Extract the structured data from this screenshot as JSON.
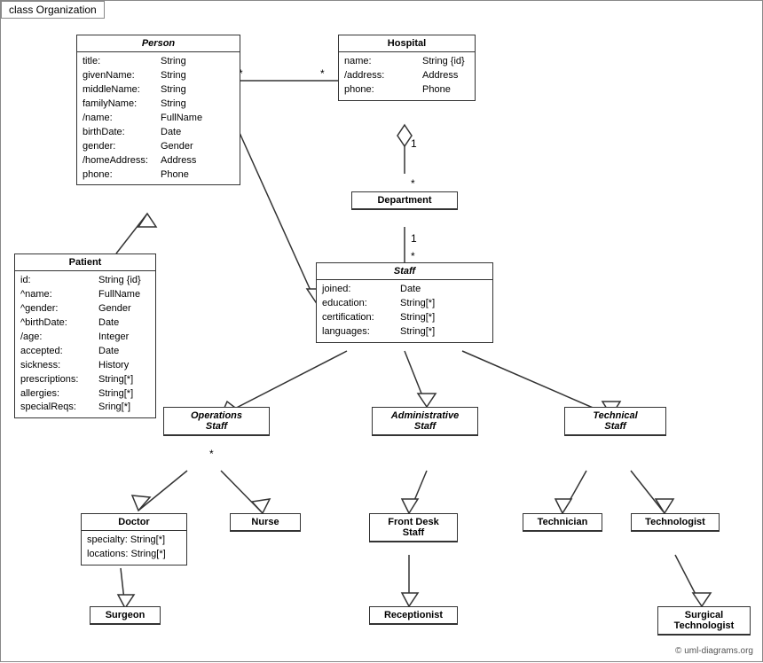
{
  "title": "class Organization",
  "classes": {
    "person": {
      "name": "Person",
      "italic": true,
      "attrs": [
        [
          "title:",
          "String"
        ],
        [
          "givenName:",
          "String"
        ],
        [
          "middleName:",
          "String"
        ],
        [
          "familyName:",
          "String"
        ],
        [
          "/name:",
          "FullName"
        ],
        [
          "birthDate:",
          "Date"
        ],
        [
          "gender:",
          "Gender"
        ],
        [
          "/homeAddress:",
          "Address"
        ],
        [
          "phone:",
          "Phone"
        ]
      ]
    },
    "hospital": {
      "name": "Hospital",
      "italic": false,
      "attrs": [
        [
          "name:",
          "String {id}"
        ],
        [
          "/address:",
          "Address"
        ],
        [
          "phone:",
          "Phone"
        ]
      ]
    },
    "department": {
      "name": "Department",
      "italic": false,
      "attrs": []
    },
    "staff": {
      "name": "Staff",
      "italic": true,
      "attrs": [
        [
          "joined:",
          "Date"
        ],
        [
          "education:",
          "String[*]"
        ],
        [
          "certification:",
          "String[*]"
        ],
        [
          "languages:",
          "String[*]"
        ]
      ]
    },
    "patient": {
      "name": "Patient",
      "italic": false,
      "attrs": [
        [
          "id:",
          "String {id}"
        ],
        [
          "^name:",
          "FullName"
        ],
        [
          "^gender:",
          "Gender"
        ],
        [
          "^birthDate:",
          "Date"
        ],
        [
          "/age:",
          "Integer"
        ],
        [
          "accepted:",
          "Date"
        ],
        [
          "sickness:",
          "History"
        ],
        [
          "prescriptions:",
          "String[*]"
        ],
        [
          "allergies:",
          "String[*]"
        ],
        [
          "specialReqs:",
          "Sring[*]"
        ]
      ]
    },
    "ops_staff": {
      "name": "Operations Staff",
      "italic": true,
      "attrs": []
    },
    "admin_staff": {
      "name": "Administrative Staff",
      "italic": true,
      "attrs": []
    },
    "tech_staff": {
      "name": "Technical Staff",
      "italic": true,
      "attrs": []
    },
    "doctor": {
      "name": "Doctor",
      "italic": false,
      "attrs": [
        [
          "specialty:",
          "String[*]"
        ],
        [
          "locations:",
          "String[*]"
        ]
      ]
    },
    "nurse": {
      "name": "Nurse",
      "italic": false,
      "attrs": []
    },
    "front_desk": {
      "name": "Front Desk Staff",
      "italic": false,
      "attrs": []
    },
    "technician": {
      "name": "Technician",
      "italic": false,
      "attrs": []
    },
    "technologist": {
      "name": "Technologist",
      "italic": false,
      "attrs": []
    },
    "surgeon": {
      "name": "Surgeon",
      "italic": false,
      "attrs": []
    },
    "receptionist": {
      "name": "Receptionist",
      "italic": false,
      "attrs": []
    },
    "surgical_tech": {
      "name": "Surgical Technologist",
      "italic": false,
      "attrs": []
    }
  },
  "copyright": "© uml-diagrams.org"
}
